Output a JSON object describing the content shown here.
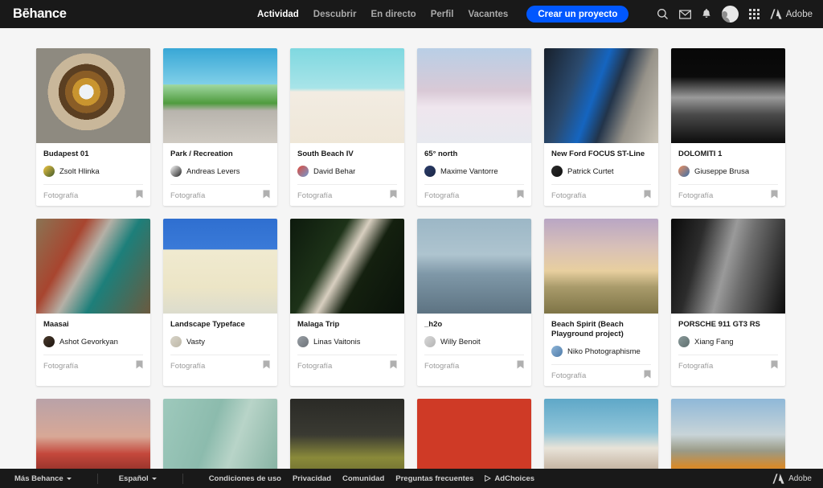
{
  "header": {
    "logo": "Bēhance",
    "nav": [
      {
        "label": "Actividad",
        "active": true
      },
      {
        "label": "Descubrir",
        "active": false
      },
      {
        "label": "En directo",
        "active": false
      },
      {
        "label": "Perfil",
        "active": false
      },
      {
        "label": "Vacantes",
        "active": false
      }
    ],
    "cta_label": "Crear un proyecto",
    "icons": [
      "search-icon",
      "mail-icon",
      "bell-icon",
      "avatar",
      "app-grid-icon"
    ],
    "adobe_label": "Adobe",
    "accent_color": "#0057ff",
    "background_color": "#191919"
  },
  "cards": [
    {
      "title": "Budapest 01",
      "owner": "Zsolt Hlinka",
      "category": "Fotografía",
      "avatar_colors": [
        "#f2c744",
        "#3f5a2a"
      ],
      "thumb": "spiral-dome"
    },
    {
      "title": "Park / Recreation",
      "owner": "Andreas Levers",
      "category": "Fotografía",
      "avatar_colors": [
        "#ffffff",
        "#222222"
      ],
      "thumb": "green-hill"
    },
    {
      "title": "South Beach IV",
      "owner": "David Behar",
      "category": "Fotografía",
      "avatar_colors": [
        "#e14b3b",
        "#6f9ad1"
      ],
      "thumb": "south-beach"
    },
    {
      "title": "65° north",
      "owner": "Maxime Vantorre",
      "category": "Fotografía",
      "avatar_colors": [
        "#2c3e6b",
        "#1b2746"
      ],
      "thumb": "church-snow"
    },
    {
      "title": "New Ford FOCUS ST-Line",
      "owner": "Patrick Curtet",
      "category": "Fotografía",
      "avatar_colors": [
        "#2b2b2b",
        "#111111"
      ],
      "thumb": "blue-car"
    },
    {
      "title": "DOLOMITI 1",
      "owner": "Giuseppe Brusa",
      "category": "Fotografía",
      "avatar_colors": [
        "#ef8f5d",
        "#3a6fa8"
      ],
      "thumb": "bw-mountain"
    },
    {
      "title": "Maasai",
      "owner": "Ashot Gevorkyan",
      "category": "Fotografía",
      "avatar_colors": [
        "#4a3a2c",
        "#1d1510"
      ],
      "thumb": "maasai"
    },
    {
      "title": "Landscape Typeface",
      "owner": "Vasty",
      "category": "Fotografía",
      "avatar_colors": [
        "#d8d4c8",
        "#bdb8a8"
      ],
      "thumb": "landscape-type"
    },
    {
      "title": "Malaga Trip",
      "owner": "Linas Vaitonis",
      "category": "Fotografía",
      "avatar_colors": [
        "#9aa0a6",
        "#6d7379"
      ],
      "thumb": "malaga"
    },
    {
      "title": "_h2o",
      "owner": "Willy Benoit",
      "category": "Fotografía",
      "avatar_colors": [
        "#d9d9d9",
        "#b4b4b4"
      ],
      "thumb": "h2o-mountain"
    },
    {
      "title": "Beach Spirit (Beach Playground project)",
      "owner": "Niko Photographisme",
      "category": "Fotografía",
      "avatar_colors": [
        "#8fb6d9",
        "#4f7ba8"
      ],
      "thumb": "beach-spirit"
    },
    {
      "title": "PORSCHE 911 GT3 RS",
      "owner": "Xiang Fang",
      "category": "Fotografía",
      "avatar_colors": [
        "#8a9a9a",
        "#5e6f6f"
      ],
      "thumb": "porsche"
    }
  ],
  "cards_row3": [
    {
      "thumb": "red-mountain-moon"
    },
    {
      "thumb": "green-towers"
    },
    {
      "thumb": "dark-hills"
    },
    {
      "thumb": "red-bag"
    },
    {
      "thumb": "old-man"
    },
    {
      "thumb": "orange-car-road"
    }
  ],
  "footer": {
    "more_behance": "Más Behance",
    "language": "Español",
    "links": [
      "Condiciones de uso",
      "Privacidad",
      "Comunidad",
      "Preguntas frecuentes"
    ],
    "adchoices": "AdChoices",
    "adobe_label": "Adobe"
  }
}
